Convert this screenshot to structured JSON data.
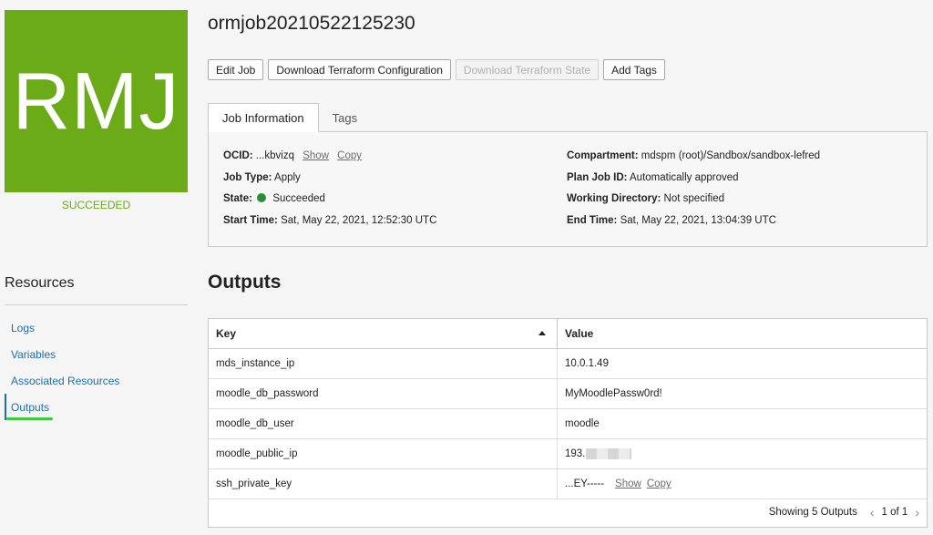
{
  "logo": {
    "text": "RMJ",
    "status": "SUCCEEDED"
  },
  "page": {
    "title": "ormjob20210522125230"
  },
  "toolbar": {
    "edit_job": "Edit Job",
    "download_config": "Download Terraform Configuration",
    "download_state": "Download Terraform State",
    "add_tags": "Add Tags"
  },
  "tabs": [
    {
      "label": "Job Information",
      "active": true
    },
    {
      "label": "Tags",
      "active": false
    }
  ],
  "job_info": {
    "ocid": {
      "label": "OCID:",
      "value": "...kbvizq",
      "show": "Show",
      "copy": "Copy"
    },
    "job_type": {
      "label": "Job Type:",
      "value": "Apply"
    },
    "state": {
      "label": "State:",
      "value": "Succeeded",
      "color": "#2e8b3a"
    },
    "start_time": {
      "label": "Start Time:",
      "value": "Sat, May 22, 2021, 12:52:30 UTC"
    },
    "compartment": {
      "label": "Compartment:",
      "value": "mdspm (root)/Sandbox/sandbox-lefred"
    },
    "plan_job_id": {
      "label": "Plan Job ID:",
      "value": "Automatically approved"
    },
    "working_directory": {
      "label": "Working Directory:",
      "value": "Not specified"
    },
    "end_time": {
      "label": "End Time:",
      "value": "Sat, May 22, 2021, 13:04:39 UTC"
    }
  },
  "sidebar": {
    "heading": "Resources",
    "items": [
      {
        "label": "Logs"
      },
      {
        "label": "Variables"
      },
      {
        "label": "Associated Resources"
      },
      {
        "label": "Outputs",
        "active": true
      }
    ]
  },
  "outputs": {
    "title": "Outputs",
    "columns": {
      "key": "Key",
      "value": "Value"
    },
    "rows": [
      {
        "key": "mds_instance_ip",
        "value": "10.0.1.49"
      },
      {
        "key": "moodle_db_password",
        "value": "MyMoodlePassw0rd!"
      },
      {
        "key": "moodle_db_user",
        "value": "moodle"
      },
      {
        "key": "moodle_public_ip",
        "value": "193."
      },
      {
        "key": "ssh_private_key",
        "value": "...EY-----",
        "show": "Show",
        "copy": "Copy"
      }
    ],
    "footer": {
      "count": "Showing 5 Outputs",
      "page": "1 of 1"
    }
  },
  "colors": {
    "brand_green": "#6aab17",
    "link_blue": "#1a6fb0",
    "highlight_green": "#3ec93e"
  }
}
